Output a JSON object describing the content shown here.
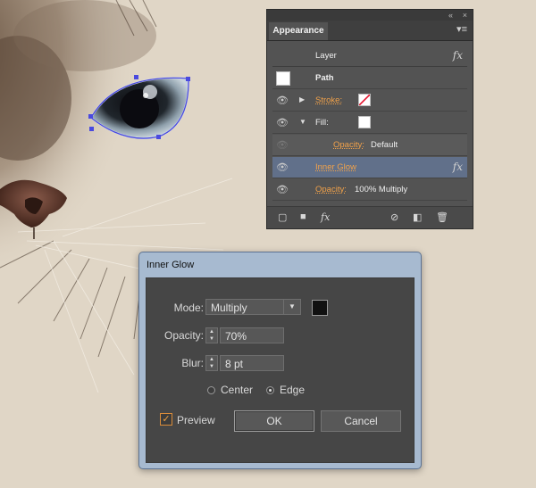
{
  "appearance_panel": {
    "collapse_glyph": "«",
    "close_glyph": "×",
    "tab": "Appearance",
    "menu_icon": "panel-menu-icon",
    "rows": {
      "layer": {
        "label": "Layer",
        "fx": "fx"
      },
      "path": {
        "label": "Path"
      },
      "stroke": {
        "label": "Stroke:",
        "swatch": "none-red-slash"
      },
      "fill": {
        "label": "Fill:",
        "swatch_color": "#ffffff"
      },
      "fill_opacity": {
        "label": "Opacity:",
        "value": "Default"
      },
      "inner_glow": {
        "label": "Inner Glow",
        "fx": "fx",
        "highlight_color": "#61708a"
      },
      "opacity": {
        "label": "Opacity:",
        "value": "100% Multiply"
      }
    },
    "bottom_bar": {
      "icons": [
        "add-stroke-icon",
        "add-fill-icon",
        "add-effect-icon",
        "clear-appearance-icon",
        "duplicate-item-icon",
        "delete-item-icon"
      ],
      "fx_label": "fx"
    }
  },
  "inner_glow_dialog": {
    "title": "Inner Glow",
    "mode": {
      "label": "Mode:",
      "value": "Multiply",
      "color": "#111111"
    },
    "opacity": {
      "label": "Opacity:",
      "value": "70%"
    },
    "blur": {
      "label": "Blur:",
      "value": "8 pt"
    },
    "source": {
      "center_label": "Center",
      "edge_label": "Edge",
      "selected": "Edge"
    },
    "preview": {
      "label": "Preview",
      "checked": true
    },
    "ok_label": "OK",
    "cancel_label": "Cancel"
  },
  "colors": {
    "canvas_bg": "#e0d6c6",
    "panel_bg": "#535353",
    "dialog_frame": "#a7bad0",
    "dialog_bg": "#464646",
    "accent_orange": "#f2a24a",
    "selection_blue": "#4a4adf"
  }
}
